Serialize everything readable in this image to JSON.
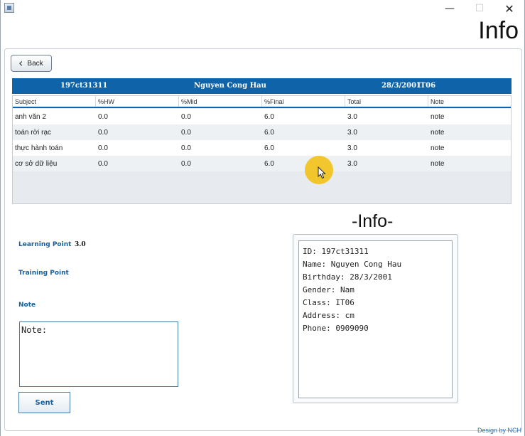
{
  "window": {
    "minimize_glyph": "—",
    "maximize_glyph": "☐",
    "close_glyph": "✕"
  },
  "page_title": "Info",
  "back_button": {
    "label": "Back"
  },
  "student_header": {
    "id": "197ct31311",
    "name": "Nguyen Cong Hau",
    "birthday": "28/3/2001",
    "class": "IT06"
  },
  "table": {
    "columns": [
      "Subject",
      "%HW",
      "%Mid",
      "%Final",
      "Total",
      "Note"
    ],
    "rows": [
      [
        "anh văn 2",
        "0.0",
        "0.0",
        "6.0",
        "3.0",
        "note"
      ],
      [
        "toán rời rạc",
        "0.0",
        "0.0",
        "6.0",
        "3.0",
        "note"
      ],
      [
        "thực hành toán",
        "0.0",
        "0.0",
        "6.0",
        "3.0",
        "note"
      ],
      [
        "cơ sở dữ liệu",
        "0.0",
        "0.0",
        "6.0",
        "3.0",
        "note"
      ]
    ]
  },
  "left_panel": {
    "learning_point_label": "Learning Point",
    "learning_point_value": "3.0",
    "training_point_label": "Training Point",
    "note_label": "Note",
    "note_text": "Note:",
    "sent_label": "Sent"
  },
  "info_panel": {
    "title": "-Info-",
    "lines": [
      "ID: 197ct31311",
      "Name: Nguyen Cong Hau",
      "Birthday: 28/3/2001",
      "Gender: Nam",
      "Class: IT06",
      "Address: cm",
      "Phone: 0909090"
    ]
  },
  "footer": "Design by NCH",
  "colors": {
    "accent": "#0e63a9",
    "label_blue": "#1a5fa0",
    "cursor_highlight": "#f2c21b"
  }
}
